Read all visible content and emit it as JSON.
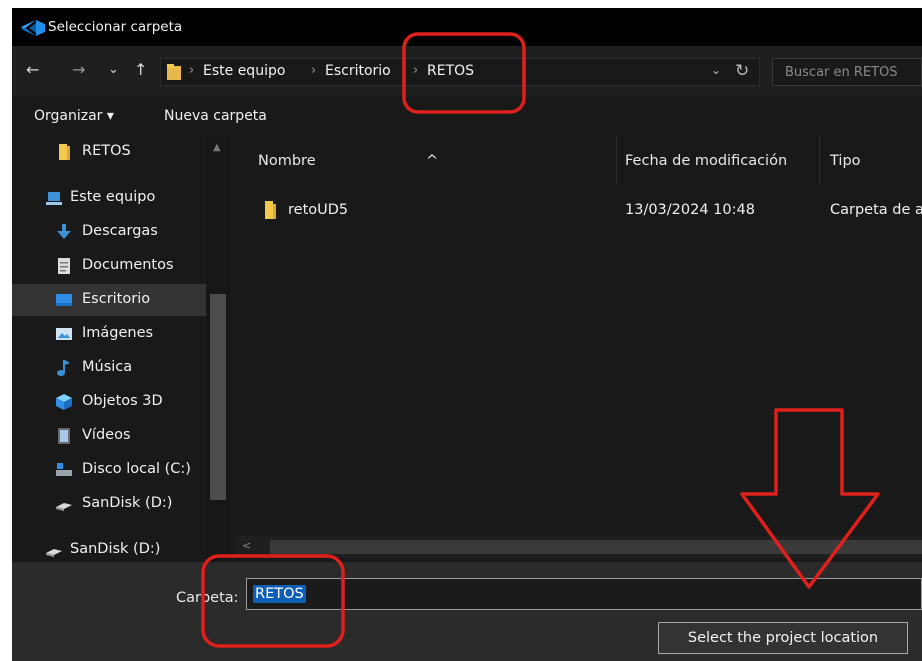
{
  "window": {
    "title": "Seleccionar carpeta"
  },
  "nav": {
    "back": "←",
    "forward": "→",
    "recent": "⌄",
    "up": "↑",
    "breadcrumbs": [
      "Este equipo",
      "Escritorio",
      "RETOS"
    ],
    "separator": "›",
    "dropdown": "⌄",
    "refresh": "↻",
    "search_placeholder": "Buscar en RETOS"
  },
  "toolbar": {
    "organize_label": "Organizar ▾",
    "new_folder_label": "Nueva carpeta"
  },
  "sidebar": {
    "items": [
      {
        "label": "RETOS",
        "icon": "folder-icon"
      },
      {
        "label": "Este equipo",
        "icon": "computer-icon"
      },
      {
        "label": "Descargas",
        "icon": "download-icon"
      },
      {
        "label": "Documentos",
        "icon": "document-icon"
      },
      {
        "label": "Escritorio",
        "icon": "desktop-icon",
        "selected": true
      },
      {
        "label": "Imágenes",
        "icon": "image-icon"
      },
      {
        "label": "Música",
        "icon": "music-icon"
      },
      {
        "label": "Objetos 3D",
        "icon": "cube-icon"
      },
      {
        "label": "Vídeos",
        "icon": "video-icon"
      },
      {
        "label": "Disco local (C:)",
        "icon": "drive-icon"
      },
      {
        "label": "SanDisk (D:)",
        "icon": "usb-drive-icon"
      },
      {
        "label": "SanDisk (D:)",
        "icon": "usb-drive-icon"
      }
    ]
  },
  "filelist": {
    "columns": [
      "Nombre",
      "Fecha de modificación",
      "Tipo"
    ],
    "rows": [
      {
        "name": "retoUD5",
        "modified": "13/03/2024 10:48",
        "type": "Carpeta de a"
      }
    ]
  },
  "bottom": {
    "folder_label": "Carpeta:",
    "folder_value": "RETOS",
    "select_button": "Select the project location"
  },
  "colors": {
    "accent": "#0c5fb5",
    "annotation": "#e0201c",
    "folder": "#f2c94c"
  }
}
